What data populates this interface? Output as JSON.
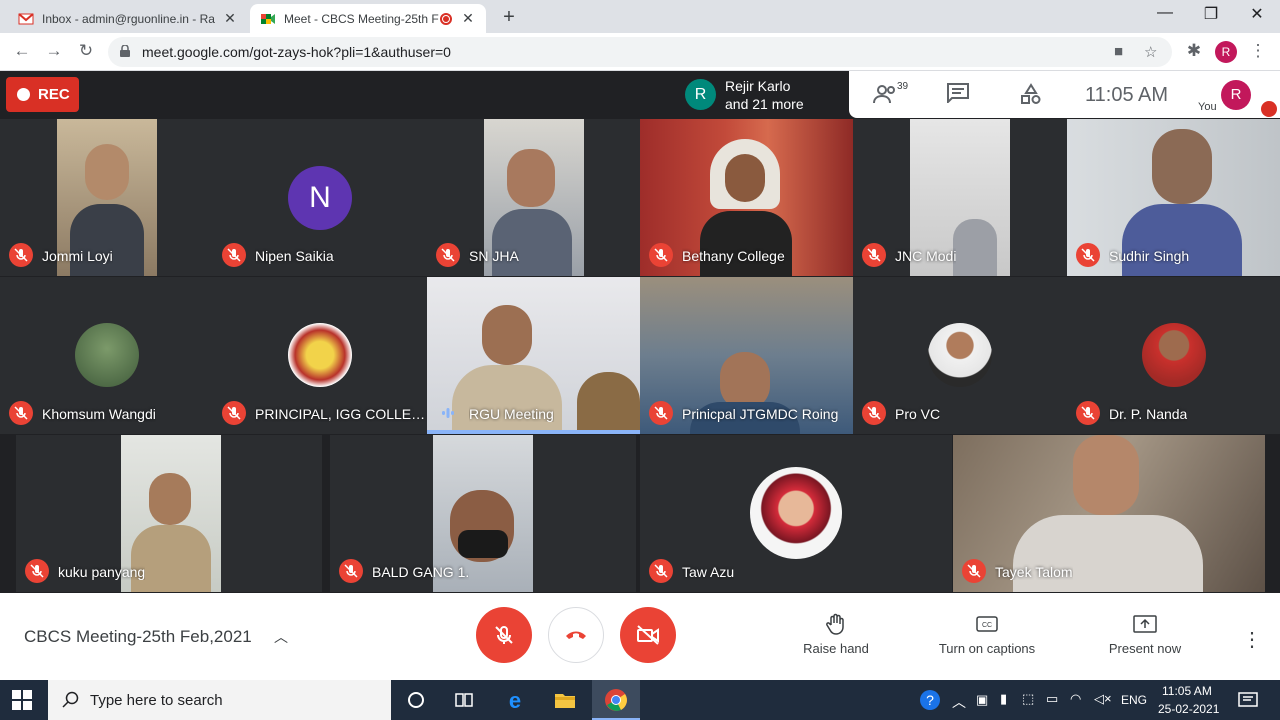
{
  "browser": {
    "tabs": [
      {
        "title": "Inbox - admin@rguonline.in - Ra"
      },
      {
        "title": "Meet - CBCS Meeting-25th F"
      }
    ],
    "new_tab_label": "+",
    "window_controls": {
      "minimize": "—",
      "restore": "❐",
      "close": "✕"
    },
    "url": "meet.google.com/got-zays-hok?pli=1&authuser=0",
    "profile_initial": "R"
  },
  "meet": {
    "rec_label": "REC",
    "speaker": {
      "initial": "R",
      "line1": "Rejir Karlo",
      "line2": "and 21 more"
    },
    "participant_count": "39",
    "time": "11:05 AM",
    "you_label": "You",
    "you_initial": "R",
    "accent": "#ea4335"
  },
  "tiles": [
    {
      "name": "Jommi Loyi"
    },
    {
      "name": "Nipen Saikia",
      "initial": "N"
    },
    {
      "name": "SN JHA"
    },
    {
      "name": "Bethany College"
    },
    {
      "name": "JNC Modi"
    },
    {
      "name": "Sudhir Singh"
    },
    {
      "name": "Khomsum Wangdi"
    },
    {
      "name": "PRINCIPAL, IGG COLLEG..."
    },
    {
      "name": "RGU Meeting"
    },
    {
      "name": "Prinicpal JTGMDC Roing"
    },
    {
      "name": "Pro VC"
    },
    {
      "name": "Dr. P. Nanda"
    },
    {
      "name": "kuku panyang"
    },
    {
      "name": "BALD GANG 1."
    },
    {
      "name": "Taw Azu"
    },
    {
      "name": "Tayek Talom"
    }
  ],
  "bottom": {
    "meeting_title": "CBCS Meeting-25th Feb,2021",
    "raise_hand": "Raise hand",
    "captions": "Turn on captions",
    "present": "Present now"
  },
  "taskbar": {
    "search_placeholder": "Type here to search",
    "lang": "ENG",
    "time": "11:05 AM",
    "date": "25-02-2021"
  }
}
